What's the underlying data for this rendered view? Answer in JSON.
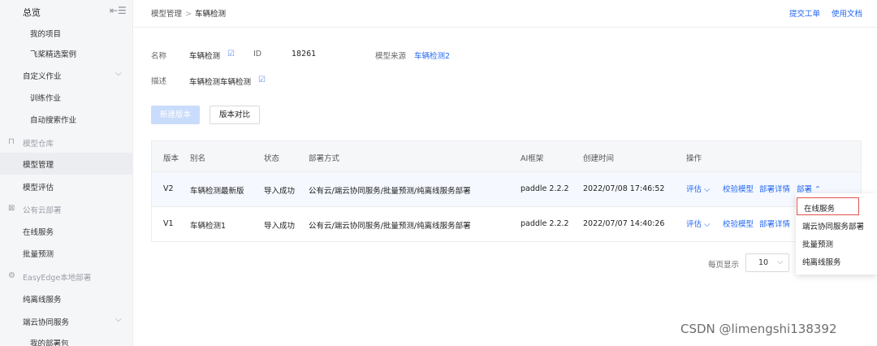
{
  "sidebar": {
    "title": "总览",
    "items": [
      {
        "label": "我的项目"
      },
      {
        "label": "飞桨精选案例"
      },
      {
        "label": "自定义作业"
      },
      {
        "label": "训练作业"
      },
      {
        "label": "自动搜索作业"
      },
      {
        "label": "模型仓库"
      },
      {
        "label": "模型管理"
      },
      {
        "label": "模型评估"
      },
      {
        "label": "公有云部署"
      },
      {
        "label": "在线服务"
      },
      {
        "label": "批量预测"
      },
      {
        "label": "EasyEdge本地部署"
      },
      {
        "label": "纯离线服务"
      },
      {
        "label": "端云协同服务"
      },
      {
        "label": "我的部署包"
      }
    ]
  },
  "header": {
    "breadcrumb_parent": "模型管理",
    "breadcrumb_current": "车辆检测",
    "links": [
      "提交工单",
      "使用文档"
    ]
  },
  "info": {
    "name_label": "名称",
    "name_value": "车辆检测",
    "id_label": "ID",
    "id_value": "18261",
    "source_label": "模型来源",
    "source_value": "车辆检测2",
    "desc_label": "描述",
    "desc_value": "车辆检测车辆检测"
  },
  "toolbar": {
    "new_version": "新建版本",
    "compare": "版本对比"
  },
  "table": {
    "headers": [
      "版本",
      "别名",
      "状态",
      "部署方式",
      "AI框架",
      "创建时间",
      "操作"
    ],
    "rows": [
      {
        "version": "V2",
        "alias": "车辆检测最新版",
        "status": "导入成功",
        "deploy": "公有云/端云协同服务/批量预测/纯离线服务部署",
        "framework": "paddle 2.2.2",
        "created": "2022/07/08 17:46:52",
        "ops": [
          "评估 ⌵",
          "校验模型",
          "部署详情",
          "部署 ⌃"
        ]
      },
      {
        "version": "V1",
        "alias": "车辆检测1",
        "status": "导入成功",
        "deploy": "公有云/端云协同服务/批量预测/纯离线服务部署",
        "framework": "paddle 2.2.2",
        "created": "2022/07/07 14:40:26",
        "ops": [
          "评估 ⌵",
          "校验模型",
          "部署详情"
        ]
      }
    ]
  },
  "pagination": {
    "label": "每页显示",
    "size": "10"
  },
  "dropdown": {
    "items": [
      "在线服务",
      "端云协同服务部署",
      "批量预测",
      "纯离线服务"
    ]
  },
  "watermark": "CSDN @limengshi138392",
  "colors": {
    "accent": "#2468f2",
    "highlight_border": "#e0524d",
    "sidebar_bg": "#f5f6f8"
  }
}
